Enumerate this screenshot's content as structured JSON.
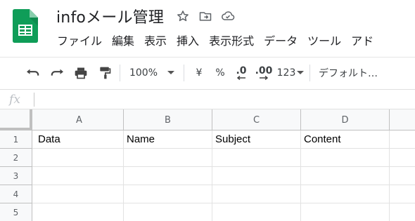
{
  "app": {
    "document_title": "infoメール管理",
    "brand_color": "#0f9d58"
  },
  "menu": {
    "items": [
      "ファイル",
      "編集",
      "表示",
      "挿入",
      "表示形式",
      "データ",
      "ツール",
      "アド"
    ]
  },
  "toolbar": {
    "zoom": "100%",
    "currency": "¥",
    "percent": "%",
    "decimal_decrease": ".0",
    "decimal_increase": ".00",
    "number_format": "123",
    "font": "デフォルト…"
  },
  "formula_bar": {
    "fx_label": "fx",
    "value": ""
  },
  "sheet": {
    "columns": [
      "A",
      "B",
      "C",
      "D"
    ],
    "rows": [
      {
        "num": "1",
        "cells": [
          "Data",
          "Name",
          "Subject",
          "Content"
        ]
      },
      {
        "num": "2",
        "cells": [
          "",
          "",
          "",
          ""
        ]
      },
      {
        "num": "3",
        "cells": [
          "",
          "",
          "",
          ""
        ]
      },
      {
        "num": "4",
        "cells": [
          "",
          "",
          "",
          ""
        ]
      },
      {
        "num": "5",
        "cells": [
          "",
          "",
          "",
          ""
        ]
      }
    ]
  }
}
